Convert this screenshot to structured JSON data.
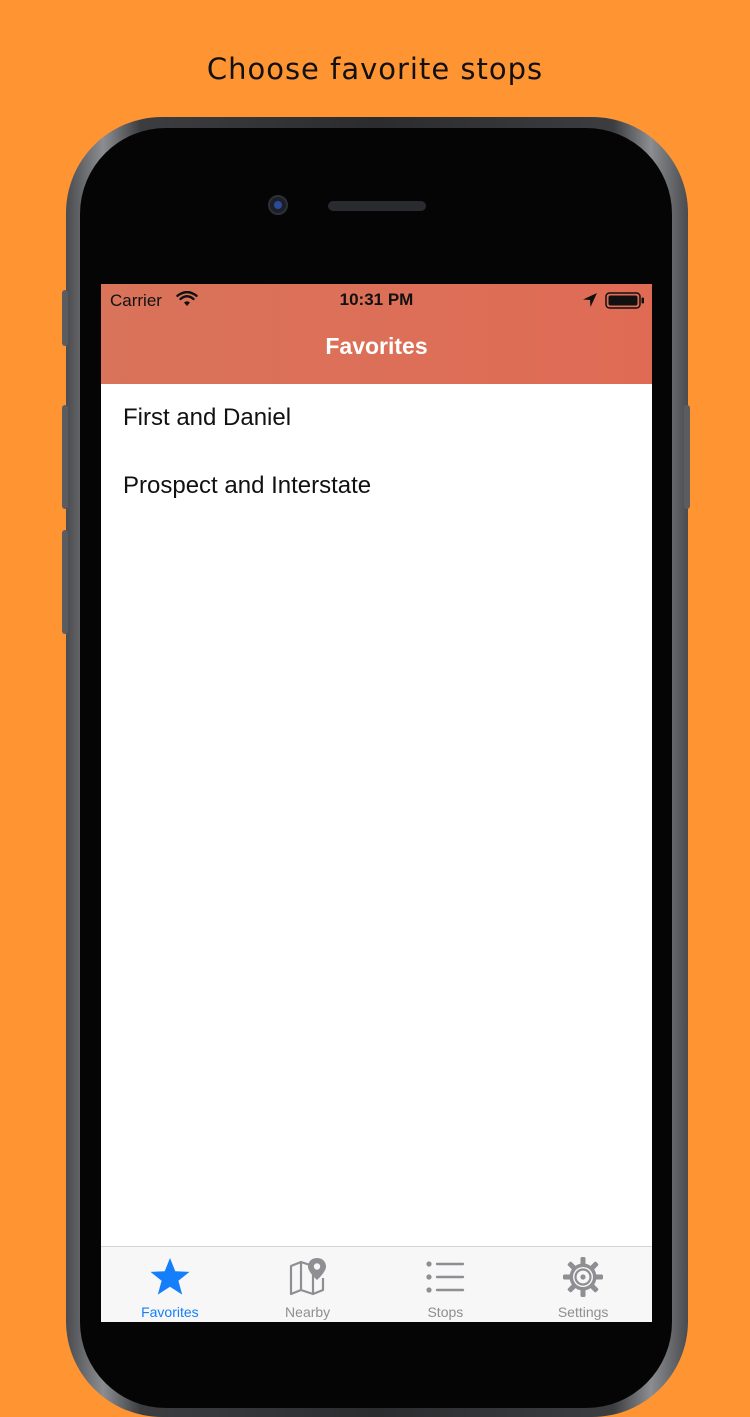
{
  "caption": "Choose favorite stops",
  "status_bar": {
    "carrier": "Carrier",
    "time": "10:31 PM"
  },
  "nav": {
    "title": "Favorites"
  },
  "favorites": [
    {
      "label": "First and Daniel"
    },
    {
      "label": "Prospect and Interstate"
    }
  ],
  "tabs": [
    {
      "label": "Favorites",
      "icon": "star-icon",
      "active": true
    },
    {
      "label": "Nearby",
      "icon": "map-pin-icon",
      "active": false
    },
    {
      "label": "Stops",
      "icon": "list-icon",
      "active": false
    },
    {
      "label": "Settings",
      "icon": "gear-icon",
      "active": false
    }
  ],
  "colors": {
    "background": "#ff9433",
    "nav_bar": "#df6e56",
    "active_tab": "#157efb",
    "inactive_tab": "#8e8e93"
  }
}
